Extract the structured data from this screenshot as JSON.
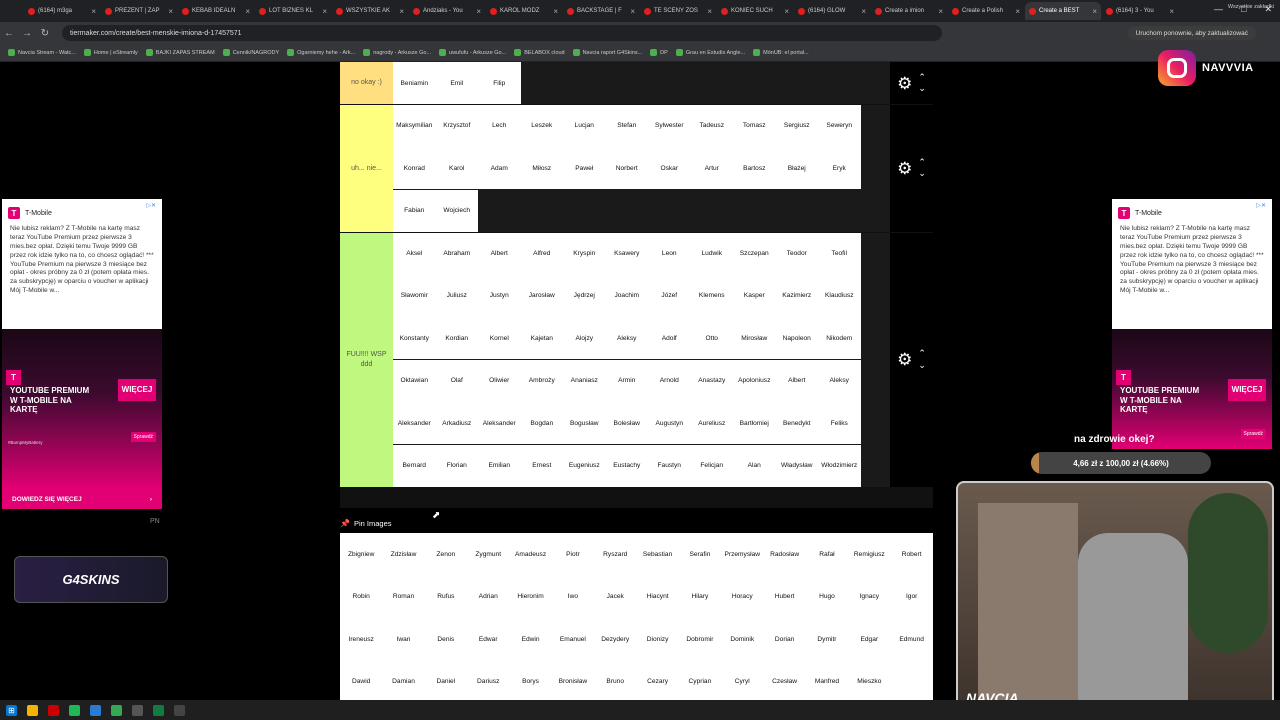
{
  "browser": {
    "tabs": [
      {
        "label": "(6164) m3ga"
      },
      {
        "label": "PREZENT | ZAP"
      },
      {
        "label": "KEBAB IDEALN"
      },
      {
        "label": "LOT BIZNES KL"
      },
      {
        "label": "WSZYSTKIE AK"
      },
      {
        "label": "Andziaks - You"
      },
      {
        "label": "KAROL MODZ"
      },
      {
        "label": "BACKSTAGE | F"
      },
      {
        "label": "TE SCENY ZOS"
      },
      {
        "label": "KONIEC SUCH"
      },
      {
        "label": "(6164) GLOW"
      },
      {
        "label": "Create a imion"
      },
      {
        "label": "Create a Polish"
      },
      {
        "label": "Create a BEST"
      },
      {
        "label": "(6164) 3 - You"
      }
    ],
    "active_tab_index": 13,
    "url": "tiermaker.com/create/best-menskie-imiona-d-17457571",
    "relaunch_label": "Uruchom ponownie, aby zaktualizować",
    "bookmarks": [
      "Navcia Stream - Watc...",
      "Home | eStreamly",
      "BAJKI ZAPAS STREAM",
      "Cennik/NAGRODY",
      "Ogarniemy hehe - Ark...",
      "nagrody - Arkusze Go...",
      "uwufufu - Arkusze Go...",
      "BELABOX cloud",
      "Navcia raport G4Skins...",
      "DP",
      "Grau en Estudis Angle...",
      "MónUB: el portal..."
    ],
    "all_bookmarks_label": "Wszystkie zakładki"
  },
  "tiers": [
    {
      "label": "no okay :)",
      "color": "#ffdf80",
      "rows": [
        [
          "Beniamin",
          "Emil",
          "Filip"
        ]
      ]
    },
    {
      "label": "uh... nie...",
      "color": "#ffff7f",
      "rows": [
        [
          "Maksymilian",
          "Krzysztof",
          "Lech",
          "Leszek",
          "Lucjan",
          "Stefan",
          "Sylwester",
          "Tadeusz",
          "Tomasz",
          "Sergiusz",
          "Seweryn"
        ],
        [
          "Konrad",
          "Karol",
          "Adam",
          "Miłosz",
          "Paweł",
          "Norbert",
          "Oskar",
          "Artur",
          "Bartosz",
          "Błażej",
          "Eryk"
        ],
        [
          "Fabian",
          "Wojciech"
        ]
      ]
    },
    {
      "label": "FUU!!!! WSP ddd",
      "color": "#bff77f",
      "rows": [
        [
          "Aksel",
          "Abraham",
          "Albert",
          "Alfred",
          "Kryspin",
          "Ksawery",
          "Leon",
          "Ludwik",
          "Szczepan",
          "Teodor",
          "Teofil"
        ],
        [
          "Sławomir",
          "Juliusz",
          "Justyn",
          "Jarosław",
          "Jędrzej",
          "Joachim",
          "Józef",
          "Klemens",
          "Kasper",
          "Kazimierz",
          "Klaudiusz"
        ],
        [
          "Konstanty",
          "Kordian",
          "Kornel",
          "Kajetan",
          "Alojzy",
          "Aleksy",
          "Adolf",
          "Otto",
          "Mirosław",
          "Napoleon",
          "Nikodem"
        ],
        [
          "Oktawian",
          "Olaf",
          "Oliwier",
          "Ambroży",
          "Ananiasz",
          "Armin",
          "Arnold",
          "Anastazy",
          "Apoloniusz",
          "Albert",
          "Aleksy"
        ],
        [
          "Aleksander",
          "Arkadiusz",
          "Aleksander",
          "Bogdan",
          "Bogusław",
          "Bolesław",
          "Augustyn",
          "Aureliusz",
          "Bartłomiej",
          "Benedykt",
          "Feliks"
        ],
        [
          "Bernard",
          "Florian",
          "Emilian",
          "Ernest",
          "Eugeniusz",
          "Eustachy",
          "Faustyn",
          "Felicjan",
          "Alan",
          "Władysław",
          "Włodzimierz"
        ]
      ]
    }
  ],
  "pin_label": "Pin Images",
  "pool": [
    [
      "Zbigniew",
      "Zdzisław",
      "Zenon",
      "Zygmunt",
      "Amadeusz",
      "Piotr",
      "Ryszard",
      "Sebastian",
      "Serafin",
      "Przemysław",
      "Radosław",
      "Rafał",
      "Remigiusz",
      "Robert"
    ],
    [
      "Robin",
      "Roman",
      "Rufus",
      "Adrian",
      "Hieronim",
      "Iwo",
      "Jacek",
      "Hiacynt",
      "Hilary",
      "Horacy",
      "Hubert",
      "Hugo",
      "Ignacy",
      "Igor"
    ],
    [
      "Ireneusz",
      "Iwan",
      "Denis",
      "Edwar",
      "Edwin",
      "Emanuel",
      "Dezydery",
      "Dionizy",
      "Dobromir",
      "Dominik",
      "Dorian",
      "Dymitr",
      "Edgar",
      "Edmund"
    ],
    [
      "Dawid",
      "Damian",
      "Daniel",
      "Dariusz",
      "Borys",
      "Bronisław",
      "Bruno",
      "Cezary",
      "Cyprian",
      "Cyryl",
      "Czesław",
      "Manfred",
      "Mieszko"
    ]
  ],
  "ads": {
    "brand": "T-Mobile",
    "text": "Nie lubisz reklam? Z T-Mobile na kartę masz teraz YouTube Premium przez pierwsze 3 mies.bez opłat. Dzięki temu Twoje 9999 GB przez rok idzie tylko na to, co chcesz oglądać! *** YouTube Premium na pierwsze 3 miesiące bez opłat - okres próbny za 0 zł (potem opłata mies. za subskrypcję) w oparciu o voucher w aplikacji Mój T-Mobile w...",
    "banner": "YOUTUBE PREMIUM W T-MOBILE NA KARTĘ",
    "more_label": "WIĘCEJ",
    "check_label": "Sprawdź",
    "hashtag": "#BumpMyBattery",
    "cta": "DOWIEDZ SIĘ WIĘCEJ",
    "info_icon": "adchoices-icon"
  },
  "overlay": {
    "pn": "PN",
    "sponsor": "G4SKINS",
    "instagram": "NAVVVIA",
    "goal_title": "na zdrowie okej?",
    "goal_text": "4,66 zł z 100,00 zł (4.66%)",
    "goal_fraction": 0.0466,
    "cam_name": "NAVCIA"
  }
}
